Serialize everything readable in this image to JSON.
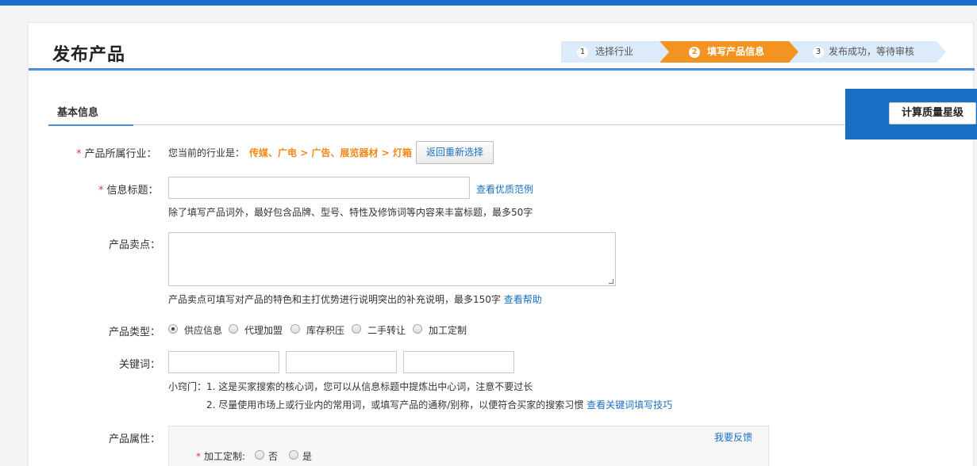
{
  "page": {
    "title": "发布产品"
  },
  "steps": [
    {
      "num": "1",
      "label": "选择行业"
    },
    {
      "num": "2",
      "label": "填写产品信息"
    },
    {
      "num": "3",
      "label": "发布成功，等待审核"
    }
  ],
  "section": {
    "title": "基本信息"
  },
  "quality": {
    "button": "计算质量星级"
  },
  "industry": {
    "label": "产品所属行业：",
    "current_prefix": "您当前的行业是：",
    "path": "传媒、广电 > 广告、展览器材 > 灯箱",
    "reselect": "返回重新选择"
  },
  "title_field": {
    "label": "信息标题：",
    "value": "",
    "examples_link": "查看优质范例",
    "hint": "除了填写产品词外，最好包含品牌、型号、特性及修饰词等内容来丰富标题，最多50字"
  },
  "selling_point": {
    "label": "产品卖点：",
    "value": "",
    "hint": "产品卖点可填写对产品的特色和主打优势进行说明突出的补充说明，最多150字",
    "help_link": "查看帮助"
  },
  "product_type": {
    "label": "产品类型：",
    "options": [
      "供应信息",
      "代理加盟",
      "库存积压",
      "二手转让",
      "加工定制"
    ],
    "selected": "供应信息"
  },
  "keywords": {
    "label": "关键词：",
    "values": [
      "",
      "",
      ""
    ],
    "tip1": "小窍门：1. 这是买家搜索的核心词，您可以从信息标题中提炼出中心词，注意不要过长",
    "tip2": "2. 尽量使用市场上或行业内的常用词，或填写产品的通称/别称，以便符合买家的搜索习惯",
    "tip_link": "查看关键词填写技巧"
  },
  "attributes": {
    "label": "产品属性：",
    "feedback": "我要反馈",
    "custom_label": "加工定制:",
    "options": [
      "否",
      "是"
    ]
  },
  "colors": {
    "accent": "#1a6fd1",
    "step_active": "#f39322",
    "step_inactive": "#dcebf9",
    "required": "#e03a3a",
    "link": "#1a6fc4"
  }
}
